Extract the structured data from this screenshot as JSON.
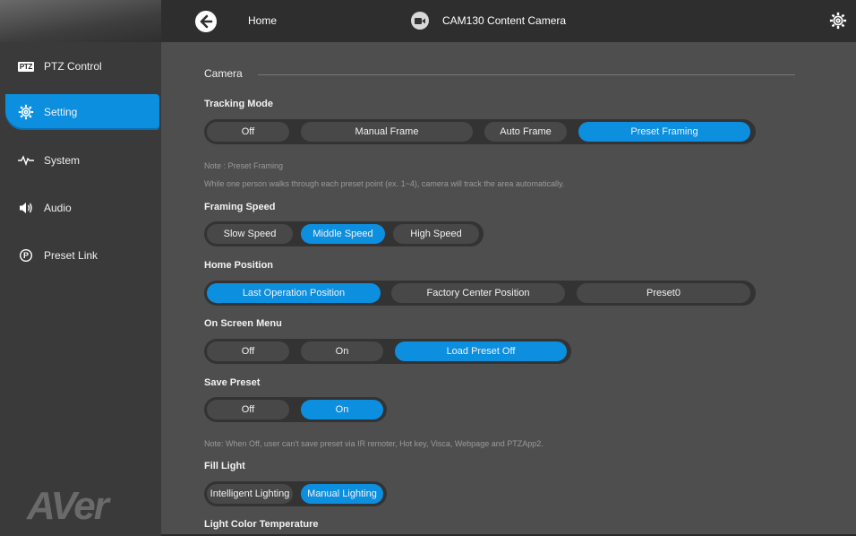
{
  "brand": "AVer",
  "topbar": {
    "home_label": "Home",
    "camera_title": "CAM130 Content Camera"
  },
  "sidebar": {
    "items": [
      {
        "label": "PTZ Control",
        "badge": "PTZ"
      },
      {
        "label": "Setting"
      },
      {
        "label": "System"
      },
      {
        "label": "Audio"
      },
      {
        "label": "Preset Link"
      }
    ]
  },
  "camera": {
    "section_title": "Camera",
    "tracking_mode": {
      "label": "Tracking Mode",
      "options": [
        "Off",
        "Manual Frame",
        "Auto Frame",
        "Preset Framing"
      ],
      "selected": "Preset Framing"
    },
    "tracking_note_title": "Note : Preset Framing",
    "tracking_note_text": "While one person walks through each preset point (ex. 1~4), camera will track the area automatically.",
    "framing_speed": {
      "label": "Framing Speed",
      "options": [
        "Slow Speed",
        "Middle Speed",
        "High Speed"
      ],
      "selected": "Middle Speed"
    },
    "home_position": {
      "label": "Home Position",
      "options": [
        "Last Operation Position",
        "Factory Center Position",
        "Preset0"
      ],
      "selected": "Last Operation Position"
    },
    "on_screen_menu": {
      "label": "On Screen Menu",
      "options": [
        "Off",
        "On",
        "Load Preset Off"
      ],
      "selected": "Load Preset Off"
    },
    "save_preset": {
      "label": "Save Preset",
      "options": [
        "Off",
        "On"
      ],
      "selected": "On"
    },
    "save_preset_note": "Note: When Off, user can't save preset via IR remoter, Hot key, Visca, Webpage and PTZApp2.",
    "fill_light": {
      "label": "Fill Light",
      "options": [
        "Intelligent Lighting",
        "Manual Lighting"
      ],
      "selected": "Manual Lighting"
    },
    "light_color_temp": {
      "label": "Light Color Temperature"
    }
  },
  "colors": {
    "accent": "#0d8fe0",
    "sidebar_bg": "#3a3a3a",
    "topbar_bg": "#2e2e2e",
    "content_bg": "#4e4e4e"
  }
}
